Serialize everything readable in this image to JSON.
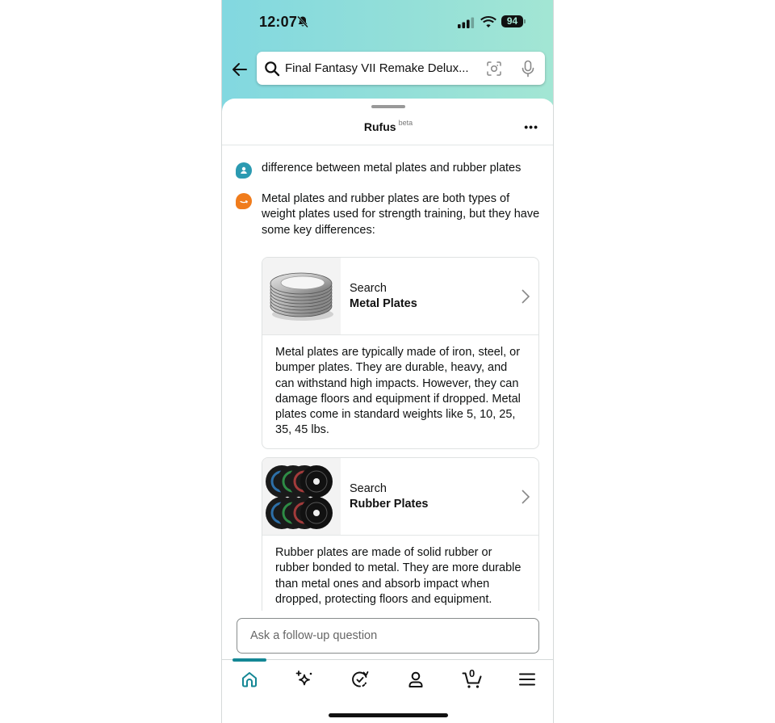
{
  "status_bar": {
    "time": "12:07",
    "battery": "94",
    "icons": [
      "bell-slash-icon",
      "signal-icon",
      "wifi-icon",
      "battery-icon"
    ]
  },
  "search": {
    "query": "Final Fantasy VII Remake Delux...",
    "icons": [
      "back-arrow-icon",
      "search-icon",
      "camera-scan-icon",
      "microphone-icon"
    ]
  },
  "sheet": {
    "title": "Rufus",
    "badge": "beta",
    "more_label": "•••"
  },
  "conversation": {
    "user_message": "difference between metal plates and rubber plates",
    "bot_intro": "Metal plates and rubber plates are both types of weight plates used for strength training, but they have some key differences:",
    "cards": [
      {
        "search_label": "Search",
        "title": "Metal Plates",
        "description": "Metal plates are typically made of iron, steel, or bumper plates. They are durable, heavy, and can withstand high impacts. However, they can damage floors and equipment if dropped. Metal plates come in standard weights like 5, 10, 25, 35, 45 lbs."
      },
      {
        "search_label": "Search",
        "title": "Rubber Plates",
        "description": "Rubber plates are made of solid rubber or rubber bonded to metal. They are more durable than metal ones and absorb impact when dropped, protecting floors and equipment."
      }
    ]
  },
  "followup": {
    "placeholder": "Ask a follow-up question"
  },
  "bottom_nav": {
    "items": [
      "home",
      "rufus-sparkle",
      "buy-again",
      "account",
      "cart",
      "menu"
    ],
    "active": "home",
    "cart_count": "0"
  },
  "colors": {
    "accent": "#148795",
    "user_avatar": "#2b9ab1",
    "bot_avatar": "#f07c1c",
    "header_gradient_start": "#82d8e0",
    "header_gradient_end": "#a3e6d4"
  }
}
